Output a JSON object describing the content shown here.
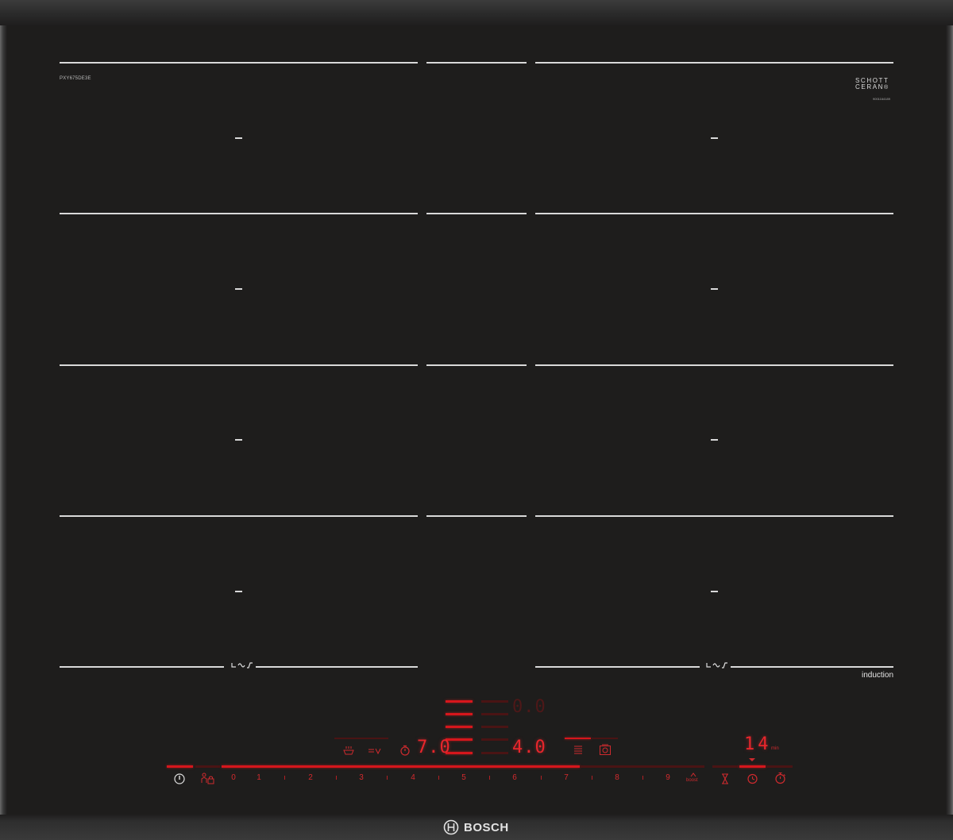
{
  "appliance": {
    "model_number": "PXY675DE3E",
    "glass_brand": {
      "line1": "SCHOTT",
      "line2": "CERAN",
      "mark": "®"
    },
    "serial_number": "9001164189",
    "technology_label": "induction",
    "brand": "BOSCH"
  },
  "zones": {
    "left_column_flex_icon": "flexinduction-icon",
    "right_column_flex_icon": "flexinduction-icon"
  },
  "displays": {
    "top_center": "0.0",
    "left_level": "7.0",
    "right_level": "4.0",
    "timer_value": "14",
    "timer_unit": "min"
  },
  "control_panel": {
    "power_icon": "power-icon",
    "childlock_icon": "childlock-icon",
    "scale": [
      "0",
      "1",
      "2",
      "3",
      "4",
      "5",
      "6",
      "7",
      "8",
      "9"
    ],
    "boost_label": "boost",
    "boost_icon": "boost-icon",
    "hourglass_icon": "hourglass-icon",
    "timer_icon": "clock-timer-icon",
    "stopwatch_icon": "stopwatch-icon",
    "function_icons": [
      "pan-sensor-icon",
      "temp-sensor-icon",
      "zone-timer-icon",
      "move-mode-icon",
      "flex-mode-icon"
    ],
    "accent_color": "#d6161c"
  }
}
